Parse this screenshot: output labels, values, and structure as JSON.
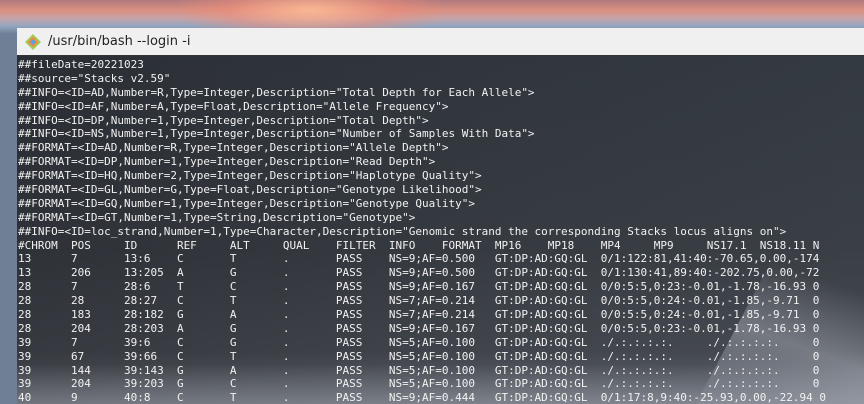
{
  "window": {
    "title": "/usr/bin/bash --login -i",
    "icon": "git-bash-diamond-icon"
  },
  "terminal": {
    "lines": [
      "##fileDate=20221023",
      "##source=\"Stacks v2.59\"",
      "##INFO=<ID=AD,Number=R,Type=Integer,Description=\"Total Depth for Each Allele\">",
      "##INFO=<ID=AF,Number=A,Type=Float,Description=\"Allele Frequency\">",
      "##INFO=<ID=DP,Number=1,Type=Integer,Description=\"Total Depth\">",
      "##INFO=<ID=NS,Number=1,Type=Integer,Description=\"Number of Samples With Data\">",
      "##FORMAT=<ID=AD,Number=R,Type=Integer,Description=\"Allele Depth\">",
      "##FORMAT=<ID=DP,Number=1,Type=Integer,Description=\"Read Depth\">",
      "##FORMAT=<ID=HQ,Number=2,Type=Integer,Description=\"Haplotype Quality\">",
      "##FORMAT=<ID=GL,Number=G,Type=Float,Description=\"Genotype Likelihood\">",
      "##FORMAT=<ID=GQ,Number=1,Type=Integer,Description=\"Genotype Quality\">",
      "##FORMAT=<ID=GT,Number=1,Type=String,Description=\"Genotype\">",
      "##INFO=<ID=loc_strand,Number=1,Type=Character,Description=\"Genomic strand the corresponding Stacks locus aligns on\">",
      "#CHROM  POS     ID      REF     ALT     QUAL    FILTER  INFO    FORMAT  MP16    MP18    MP4     MP9     NS17.1  NS18.11 N",
      "13      7       13:6    C       T       .       PASS    NS=9;AF=0.500   GT:DP:AD:GQ:GL  0/1:122:81,41:40:-70.65,0.00,-174",
      "13      206     13:205  A       G       .       PASS    NS=9;AF=0.500   GT:DP:AD:GQ:GL  0/1:130:41,89:40:-202.75,0.00,-72",
      "28      7       28:6    T       C       .       PASS    NS=9;AF=0.167   GT:DP:AD:GQ:GL  0/0:5:5,0:23:-0.01,-1.78,-16.93 0",
      "28      28      28:27   C       T       .       PASS    NS=7;AF=0.214   GT:DP:AD:GQ:GL  0/0:5:5,0:24:-0.01,-1.85,-9.71  0",
      "28      183     28:182  G       A       .       PASS    NS=7;AF=0.214   GT:DP:AD:GQ:GL  0/0:5:5,0:24:-0.01,-1.85,-9.71  0",
      "28      204     28:203  A       G       .       PASS    NS=9;AF=0.167   GT:DP:AD:GQ:GL  0/0:5:5,0:23:-0.01,-1.78,-16.93 0",
      "39      7       39:6    C       G       .       PASS    NS=5;AF=0.100   GT:DP:AD:GQ:GL  ./.:.:.:.:.     ./.:.:.:.:.     0",
      "39      67      39:66   C       T       .       PASS    NS=5;AF=0.100   GT:DP:AD:GQ:GL  ./.:.:.:.:.     ./.:.:.:.:.     0",
      "39      144     39:143  G       A       .       PASS    NS=5;AF=0.100   GT:DP:AD:GQ:GL  ./.:.:.:.:.     ./.:.:.:.:.     0",
      "39      204     39:203  G       C       .       PASS    NS=5;AF=0.100   GT:DP:AD:GQ:GL  ./.:.:.:.:.     ./.:.:.:.:.     0",
      "40      9       40:8    C       T       .       PASS    NS=9;AF=0.444   GT:DP:AD:GQ:GL  0/1:17:8,9:40:-25.93,0.00,-22.94 0"
    ]
  }
}
